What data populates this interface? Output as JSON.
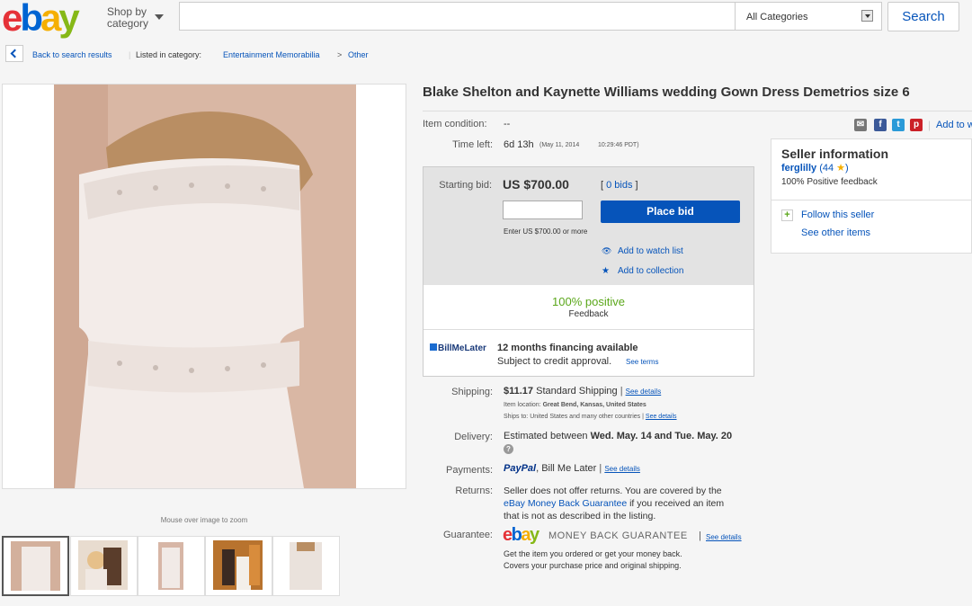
{
  "header": {
    "logo": [
      "e",
      "b",
      "a",
      "y"
    ],
    "shop_by_category": [
      "Shop by",
      "category"
    ],
    "search_placeholder": "",
    "category": "All Categories",
    "search_button": "Search"
  },
  "breadcrumb": {
    "back": "Back to search results",
    "listed_in": "Listed in category:",
    "category": "Entertainment Memorabilia",
    "separator": ">",
    "subcategory": "Other"
  },
  "images": {
    "zoom_hint": "Mouse over image to zoom",
    "thumbnail_count": 5
  },
  "item": {
    "title": "Blake Shelton and Kaynette Williams wedding Gown Dress Demetrios size 6",
    "condition_label": "Item condition:",
    "condition_value": "--",
    "time_left_label": "Time left:",
    "time_left_value": "6d 13h",
    "time_left_date": "(May 11, 2014",
    "time_left_time": "10:29:46 PDT)"
  },
  "share": {
    "icons": [
      "mail-icon",
      "facebook-icon",
      "twitter-icon",
      "pinterest-icon"
    ],
    "add_to": "Add to w"
  },
  "bid": {
    "starting_bid_label": "Starting bid:",
    "starting_bid_value": "US $700.00",
    "bids_open": "[",
    "bids_link": "0 bids",
    "bids_close": "]",
    "input_value": "",
    "place_bid": "Place bid",
    "enter_hint": "Enter US $700.00 or more",
    "watch": "Add to watch list",
    "collection": "Add to collection",
    "positive": "100% positive",
    "feedback": "Feedback",
    "billmelater_logo": "BillMeLater",
    "financing": "12 months financing available",
    "credit": "Subject to credit approval.",
    "see_terms": "See terms"
  },
  "seller": {
    "title": "Seller information",
    "name": "ferglilly",
    "score_open": "(44",
    "score_close": ")",
    "feedback": "100% Positive feedback",
    "follow": "Follow this seller",
    "see_items": "See other items"
  },
  "shipping": {
    "label": "Shipping:",
    "cost": "$11.17",
    "method": "Standard Shipping",
    "sep": "|",
    "see_details": "See details",
    "location_label": "Item location:",
    "location_value": "Great Bend, Kansas, United States",
    "ships_to_label": "Ships to:",
    "ships_to_value": "United States and many other countries",
    "ships_see_details": "See details"
  },
  "delivery": {
    "label": "Delivery:",
    "prefix": "Estimated between",
    "value": "Wed. May. 14 and Tue. May. 20"
  },
  "payments": {
    "label": "Payments:",
    "paypal": "PayPal",
    "other": ", Bill Me Later",
    "sep": "|",
    "see_details": "See details"
  },
  "returns": {
    "label": "Returns:",
    "line1": "Seller does not offer returns. You are covered by the",
    "link": "eBay Money Back Guarantee",
    "line2": "if you received an item",
    "line3": "that is not as described in the listing."
  },
  "guarantee": {
    "label": "Guarantee:",
    "logo": [
      "e",
      "b",
      "a",
      "y"
    ],
    "tagline": "MONEY BACK GUARANTEE",
    "sep": "|",
    "see_details": "See details",
    "line1": "Get the item you ordered or get your money back.",
    "line2": "Covers your purchase price and original shipping."
  },
  "colors": {
    "link": "#0654ba",
    "button": "#0654ba",
    "positive": "#5ba71b",
    "ebay_red": "#e53238",
    "ebay_blue": "#0064d2",
    "ebay_yellow": "#f5af02",
    "ebay_green": "#86b817"
  }
}
